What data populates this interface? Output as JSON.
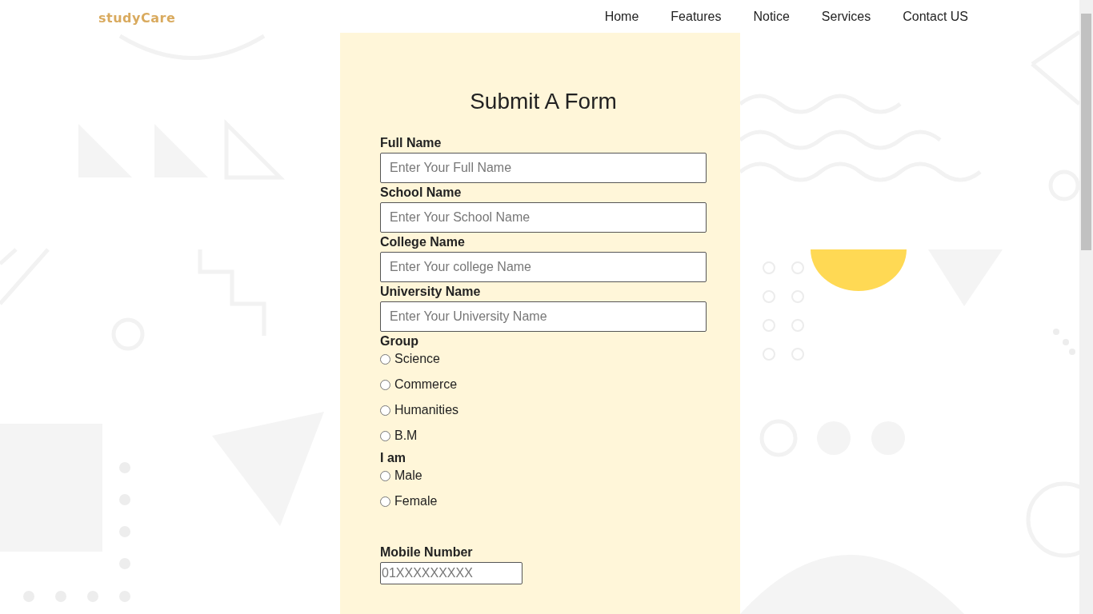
{
  "logo": "studyCare",
  "nav": [
    {
      "label": "Home"
    },
    {
      "label": "Features"
    },
    {
      "label": "Notice"
    },
    {
      "label": "Services"
    },
    {
      "label": "Contact US"
    }
  ],
  "form": {
    "title": "Submit A Form",
    "text_fields": [
      {
        "label": "Full Name",
        "placeholder": "Enter Your Full Name"
      },
      {
        "label": "School Name",
        "placeholder": "Enter Your School Name"
      },
      {
        "label": "College Name",
        "placeholder": "Enter Your college Name"
      },
      {
        "label": "University Name",
        "placeholder": "Enter Your University Name"
      }
    ],
    "radio_groups": [
      {
        "label": "Group",
        "options": [
          {
            "label": "Science",
            "selected": false
          },
          {
            "label": "Commerce",
            "selected": false
          },
          {
            "label": "Humanities",
            "selected": false
          },
          {
            "label": "B.M",
            "selected": false
          }
        ]
      },
      {
        "label": "I am",
        "options": [
          {
            "label": "Male",
            "selected": false
          },
          {
            "label": "Female",
            "selected": false
          }
        ]
      }
    ],
    "mobile": {
      "label": "Mobile Number",
      "placeholder": "01XXXXXXXXX"
    }
  }
}
